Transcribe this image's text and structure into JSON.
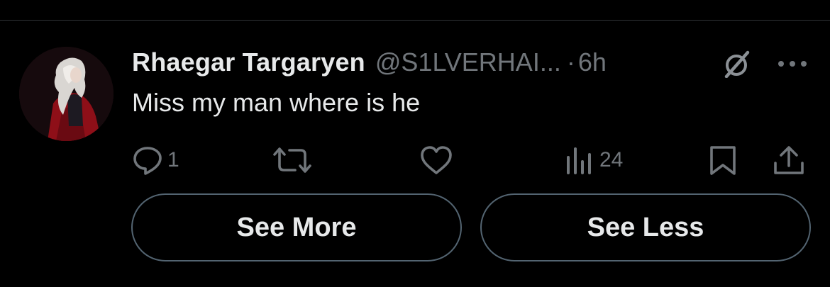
{
  "tweet": {
    "display_name": "Rhaegar Targaryen",
    "handle": "@S1LVERHAI...",
    "separator": "·",
    "time": "6h",
    "text": "Miss my man where is he"
  },
  "actions": {
    "reply_count": "1",
    "views_count": "24"
  },
  "buttons": {
    "see_more": "See More",
    "see_less": "See Less"
  },
  "icons": {
    "reply": "reply-icon",
    "retweet": "retweet-icon",
    "like": "heart-icon",
    "views": "views-icon",
    "bookmark": "bookmark-icon",
    "share": "share-icon",
    "grok": "grok-icon",
    "more": "more-icon"
  },
  "colors": {
    "background": "#000000",
    "primary_text": "#e7e9ea",
    "secondary_text": "#71767b",
    "button_border": "#536471"
  }
}
